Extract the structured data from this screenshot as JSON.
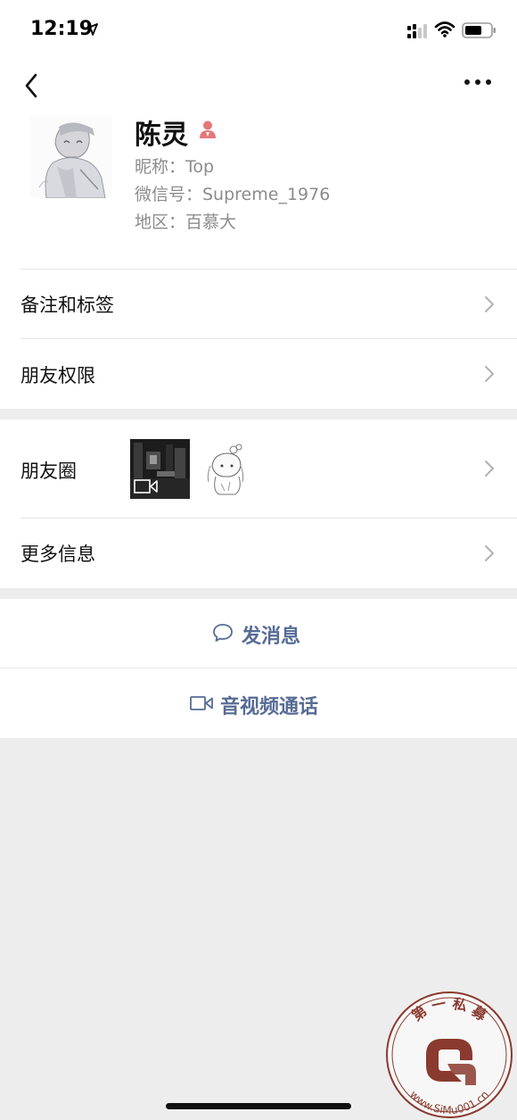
{
  "status_bar": {
    "time": "12:19",
    "icons": [
      "location-arrow-icon",
      "signal-icon",
      "wifi-icon",
      "battery-icon"
    ]
  },
  "nav": {
    "back_icon": "chevron-left-icon",
    "more_icon": "more-dots-icon"
  },
  "profile": {
    "name": "陈灵",
    "gender_icon": "person-female-icon",
    "nickname": "昵称：Top",
    "wechat_id": "微信号：Supreme_1976",
    "region": "地区：百慕大"
  },
  "rows": {
    "remark_tags": "备注和标签",
    "friend_permissions": "朋友权限",
    "moments": "朋友圈",
    "more_info": "更多信息"
  },
  "actions": {
    "send_message": "发消息",
    "audio_video_call": "音视频通话"
  },
  "watermark": {
    "top_text": "第 一 私 募",
    "url_text": "www.SiMu001.cn"
  },
  "colors": {
    "accent": "#576b95",
    "gender": "#e5777a",
    "background": "#ededed",
    "secondary_text": "#8c8c8c"
  }
}
